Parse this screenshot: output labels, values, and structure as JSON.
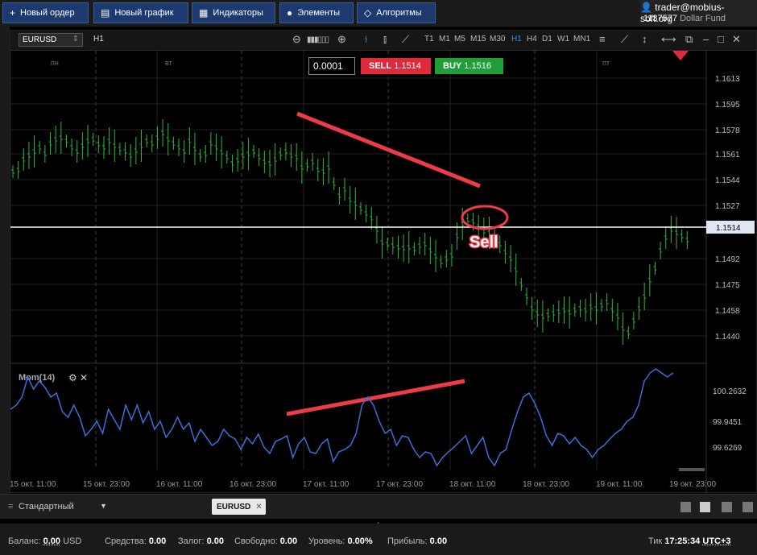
{
  "toolbar": {
    "new_order": "Новый ордер",
    "new_chart": "Новый график",
    "indicators": "Индикаторы",
    "elements": "Элементы",
    "algorithms": "Алгоритмы"
  },
  "account": {
    "user": "trader@mobius-soft.org",
    "id": "1137577",
    "fund": "Dollar Fund"
  },
  "chart": {
    "symbol": "EURUSD",
    "timeframe_label": "H1",
    "timeframes": [
      "T1",
      "M1",
      "M5",
      "M15",
      "M30",
      "H1",
      "H4",
      "D1",
      "W1",
      "MN1"
    ],
    "active_timeframe": "H1",
    "lot_step": "0.0001",
    "sell_label": "SELL",
    "sell_price": "1.1514",
    "buy_label": "BUY",
    "buy_price": "1.1516",
    "current_price": "1.1514",
    "price_axis": [
      "1.1613",
      "1.1595",
      "1.1578",
      "1.1561",
      "1.1544",
      "1.1527",
      "1.1492",
      "1.1475",
      "1.1458",
      "1.1440"
    ],
    "day_labels": [
      "пн",
      "вт",
      "пт"
    ],
    "annotation": "Sell",
    "indicator_name": "Mom(14)",
    "mom_axis": [
      "100.2632",
      "99.9451",
      "99.6269"
    ],
    "time_axis": [
      "15 окт. 11:00",
      "15 окт. 23:00",
      "16 окт. 11:00",
      "16 окт. 23:00",
      "17 окт. 11:00",
      "17 окт. 23:00",
      "18 окт. 11:00",
      "18 окт. 23:00",
      "19 окт. 11:00",
      "19 окт. 23:00"
    ],
    "colors": {
      "bull": "#2db83d",
      "line": "#3b6fd4",
      "sell": "#e0293a",
      "buy": "#1f9e3a",
      "annotation": "#ee3b47"
    }
  },
  "bottom": {
    "workspace": "Стандартный",
    "tab": "EURUSD"
  },
  "status": {
    "balance_label": "Баланс:",
    "balance": "0.00",
    "currency": "USD",
    "funds_label": "Средства:",
    "funds": "0.00",
    "margin_label": "Залог:",
    "margin": "0.00",
    "free_label": "Свободно:",
    "free": "0.00",
    "level_label": "Уровень:",
    "level": "0.00%",
    "profit_label": "Прибыль:",
    "profit": "0.00",
    "tick_label": "Тик",
    "time": "17:25:34",
    "tz": "UTC+3"
  }
}
